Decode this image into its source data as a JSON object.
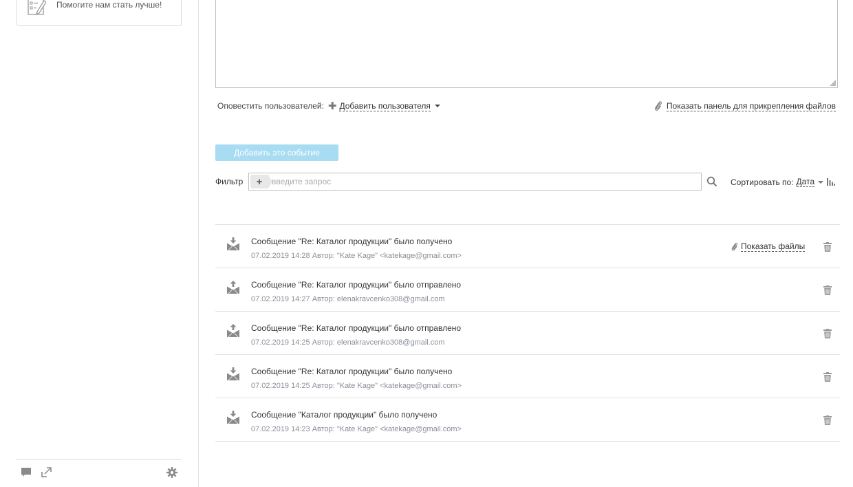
{
  "sidebar": {
    "feedback_text": "Помогите нам стать лучше!",
    "icons": {
      "feedback": "checklist-pencil-icon",
      "chat": "chat-icon",
      "expand": "expand-icon",
      "settings": "gear-icon"
    }
  },
  "notify": {
    "label": "Оповестить пользователей:",
    "add_user": "Добавить пользователя",
    "attach_panel": "Показать панель для прикрепления файлов"
  },
  "add_event_button": "Добавить это событие",
  "filter": {
    "label": "Фильтр",
    "plus": "+",
    "placeholder": "введите запрос",
    "value": ""
  },
  "sort": {
    "label": "Сортировать по:",
    "value": "Дата"
  },
  "activity": {
    "show_files_label": "Показать файлы",
    "items": [
      {
        "title": "Сообщение \"Re: Каталог продукции\" было получено",
        "meta": "07.02.2019 14:28 Автор: \"Kate Kage\" <katekage@gmail.com>",
        "direction": "received",
        "has_files": true
      },
      {
        "title": "Сообщение \"Re: Каталог продукции\" было отправлено",
        "meta": "07.02.2019 14:27 Автор: elenakravcenko308@gmail.com",
        "direction": "sent",
        "has_files": false
      },
      {
        "title": "Сообщение \"Re: Каталог продукции\" было отправлено",
        "meta": "07.02.2019 14:25 Автор: elenakravcenko308@gmail.com",
        "direction": "sent",
        "has_files": false
      },
      {
        "title": "Сообщение \"Re: Каталог продукции\" было получено",
        "meta": "07.02.2019 14:25 Автор: \"Kate Kage\" <katekage@gmail.com>",
        "direction": "received",
        "has_files": false
      },
      {
        "title": "Сообщение \"Каталог продукции\" было получено",
        "meta": "07.02.2019 14:23 Автор: \"Kate Kage\" <katekage@gmail.com>",
        "direction": "received",
        "has_files": false
      }
    ]
  },
  "colors": {
    "button_bg": "#a8dcf2",
    "border": "#e0e0e0",
    "meta_text": "#8a8f99",
    "icon": "#8a8a8a"
  }
}
